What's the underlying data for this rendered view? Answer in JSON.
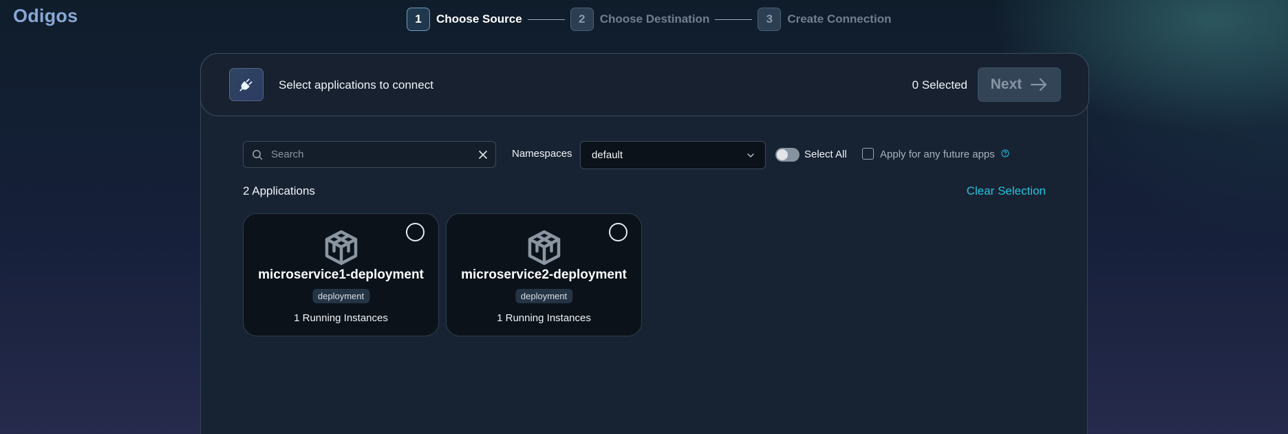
{
  "app": {
    "logo": "Odigos"
  },
  "stepper": {
    "steps": [
      {
        "number": "1",
        "label": "Choose Source",
        "active": true
      },
      {
        "number": "2",
        "label": "Choose Destination",
        "active": false
      },
      {
        "number": "3",
        "label": "Create Connection",
        "active": false
      }
    ]
  },
  "header": {
    "title": "Select applications to connect",
    "selected_count": "0  Selected",
    "next_label": "Next"
  },
  "filters": {
    "search_placeholder": "Search",
    "namespaces_label": "Namespaces",
    "namespace_value": "default",
    "select_all_label": "Select All",
    "select_all_on": false,
    "future_apps_label": "Apply for any future apps",
    "future_apps_checked": false
  },
  "list": {
    "count_label": "2 Applications",
    "clear_selection_label": "Clear Selection",
    "apps": [
      {
        "name": "microservice1-deployment",
        "kind": "deployment",
        "instances": "1 Running Instances",
        "selected": false
      },
      {
        "name": "microservice2-deployment",
        "kind": "deployment",
        "instances": "1 Running Instances",
        "selected": false
      }
    ]
  },
  "colors": {
    "accent": "#27c2e0",
    "logo": "#8aa8d6",
    "card_bg": "#0b1219",
    "panel_bg": "#172332"
  },
  "icons": [
    "plug-icon",
    "arrow-right-icon",
    "search-icon",
    "clear-icon",
    "chevron-down-icon",
    "help-icon",
    "cube-icon"
  ]
}
